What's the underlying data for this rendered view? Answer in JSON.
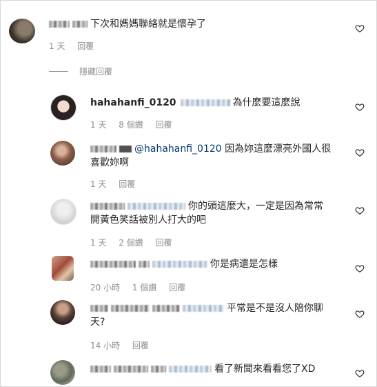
{
  "comments": [
    {
      "text": "下次和媽媽聯絡就是懷孕了",
      "time": "1 天",
      "reply": "回覆"
    },
    {
      "username": "hahahanfi_0120",
      "text": "為什麼要這麼說",
      "time": "1 天",
      "likes": "8 個讚",
      "reply": "回覆"
    },
    {
      "mention": "@hahahanfi_0120",
      "text_line1": "因為妳這麼漂亮外國人很",
      "text_line2": "喜歡妳啊",
      "time": "1 天",
      "reply": "回覆"
    },
    {
      "text_line1": "你的頭這麼大，一定是因為常常",
      "text_line2": "開黃色笑話被別人打大的吧",
      "time": "1 天",
      "likes": "2 個讚",
      "reply": "回覆"
    },
    {
      "text": "你是病還是怎樣",
      "time": "20 小時",
      "likes": "1 個讚",
      "reply": "回覆"
    },
    {
      "text_line1": "平常是不是沒人陪你聊",
      "text_line2": "天?",
      "time": "14 小時",
      "reply": "回覆"
    },
    {
      "text": "看了新聞來看看您了XD"
    }
  ],
  "hidden_replies_label": "隱藏回覆"
}
